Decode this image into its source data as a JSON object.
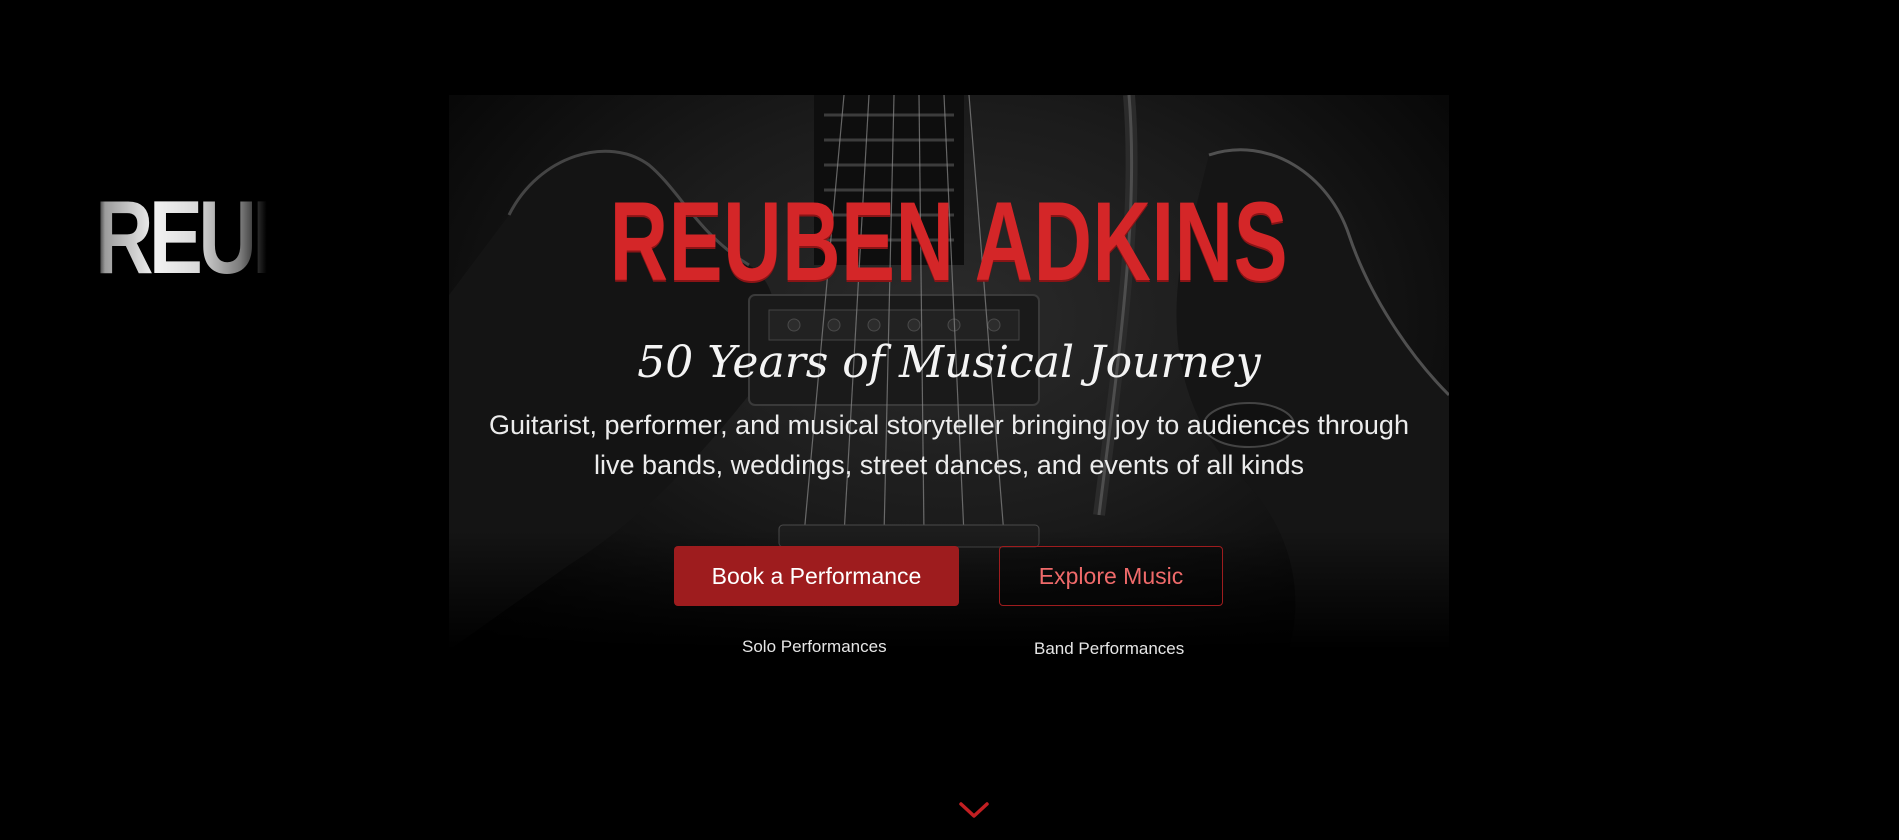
{
  "side_fragment": {
    "text": "REUBEN"
  },
  "hero": {
    "title": "REUBEN ADKINS",
    "subtitle": "50 Years of Musical Journey",
    "description": "Guitarist, performer, and musical storyteller bringing joy to audiences through live bands, weddings, street dances, and events of all kinds",
    "background_image_icon": "electric-guitar-photo"
  },
  "actions": {
    "primary": {
      "label": "Book a Performance",
      "caption": "Solo Performances"
    },
    "secondary": {
      "label": "Explore Music",
      "caption": "Band Performances"
    }
  },
  "scroll": {
    "icon": "chevron-down-icon"
  },
  "colors": {
    "accent": "#d42628",
    "button_primary": "#9e1c1e",
    "button_secondary_text": "#f06a6a",
    "background": "#000000"
  }
}
